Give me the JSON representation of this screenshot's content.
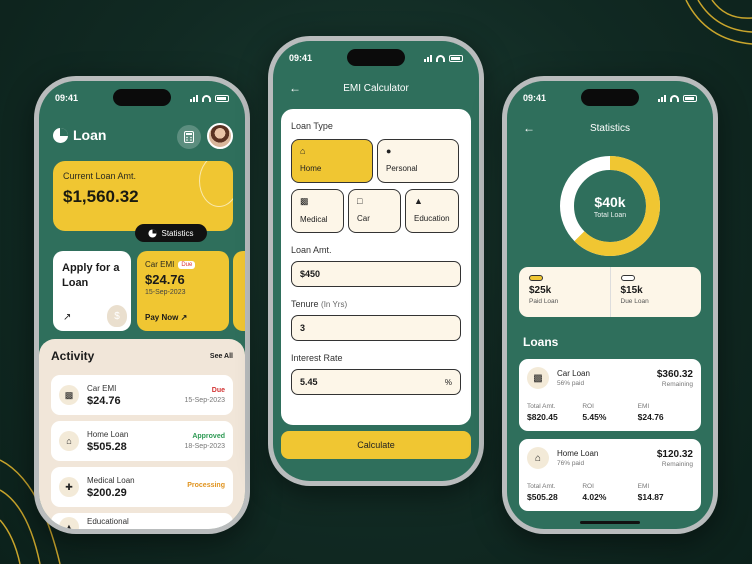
{
  "theme": {
    "accent_yellow": "#f0c632",
    "primary_green": "#2f6f5c",
    "background_dark": "#112a23",
    "cream": "#f1e6d9",
    "due_red": "#d33333",
    "approved_green": "#2e9a54",
    "processing_orange": "#e0931e"
  },
  "phone1": {
    "status": {
      "time": "09:41"
    },
    "brand": {
      "name": "Loan",
      "icon": "loan-logo-icon"
    },
    "header_icons": [
      "calculator-icon",
      "avatar"
    ],
    "current_loan": {
      "label": "Current Loan Amt.",
      "amount": "$1,560.32"
    },
    "statistics_button": {
      "label": "Statistics",
      "icon": "pie-chart-icon"
    },
    "apply_card": {
      "title": "Apply for a Loan",
      "icon": "arrow-up-right-icon",
      "decor_icon": "money-bag-icon"
    },
    "emi_card": {
      "label": "Car EMI",
      "badge": "Due",
      "amount": "$24.76",
      "date": "15-Sep-2023",
      "action": "Pay Now"
    },
    "activity": {
      "title": "Activity",
      "see_all": "See All",
      "items": [
        {
          "name": "Car EMI",
          "amount": "$24.76",
          "status": "Due",
          "date": "15-Sep-2023",
          "icon": "car-icon",
          "status_color": "#d33333"
        },
        {
          "name": "Home Loan",
          "amount": "$505.28",
          "status": "Approved",
          "date": "18-Sep-2023",
          "icon": "home-icon",
          "status_color": "#2e9a54"
        },
        {
          "name": "Medical Loan",
          "amount": "$200.29",
          "status": "Processing",
          "date": "",
          "icon": "medical-bag-icon",
          "status_color": "#e0931e"
        },
        {
          "name": "Educational",
          "amount": "",
          "status": "",
          "date": "",
          "icon": "education-icon",
          "status_color": ""
        }
      ]
    }
  },
  "phone2": {
    "status": {
      "time": "09:41"
    },
    "header": {
      "title": "EMI Calculator",
      "back_icon": "back-arrow-icon"
    },
    "loan_type": {
      "label": "Loan Type",
      "options": [
        {
          "label": "Home",
          "icon": "home-icon",
          "selected": true
        },
        {
          "label": "Personal",
          "icon": "person-icon",
          "selected": false
        },
        {
          "label": "Medical",
          "icon": "medical-bag-icon",
          "selected": false
        },
        {
          "label": "Car",
          "icon": "car-icon",
          "selected": false
        },
        {
          "label": "Education",
          "icon": "graduation-cap-icon",
          "selected": false
        }
      ]
    },
    "loan_amt": {
      "label": "Loan Amt.",
      "value": "$450"
    },
    "tenure": {
      "label": "Tenure",
      "unit_label": "(In Yrs)",
      "value": "3"
    },
    "interest": {
      "label": "Interest Rate",
      "value": "5.45",
      "unit": "%"
    },
    "calculate_button": "Calculate"
  },
  "phone3": {
    "status": {
      "time": "09:41"
    },
    "header": {
      "title": "Statistics",
      "back_icon": "back-arrow-icon"
    },
    "donut": {
      "total_value": "$40k",
      "total_label": "Total Loan",
      "paid_fraction": 0.625
    },
    "summary": [
      {
        "value": "$25k",
        "label": "Paid Loan",
        "swatch": "#f0c632"
      },
      {
        "value": "$15k",
        "label": "Due Loan",
        "swatch": "#ffffff"
      }
    ],
    "loans_title": "Loans",
    "loans": [
      {
        "name": "Car Loan",
        "paid": "56% paid",
        "amount": "$360.32",
        "remaining": "Remaining",
        "icon": "car-icon",
        "total_label": "Total Amt.",
        "total": "$820.45",
        "roi_label": "ROI",
        "roi": "5.45%",
        "emi_label": "EMI",
        "emi": "$24.76"
      },
      {
        "name": "Home Loan",
        "paid": "76% paid",
        "amount": "$120.32",
        "remaining": "Remaining",
        "icon": "home-icon",
        "total_label": "Total Amt.",
        "total": "$505.28",
        "roi_label": "ROI",
        "roi": "4.02%",
        "emi_label": "EMI",
        "emi": "$14.87"
      }
    ]
  }
}
